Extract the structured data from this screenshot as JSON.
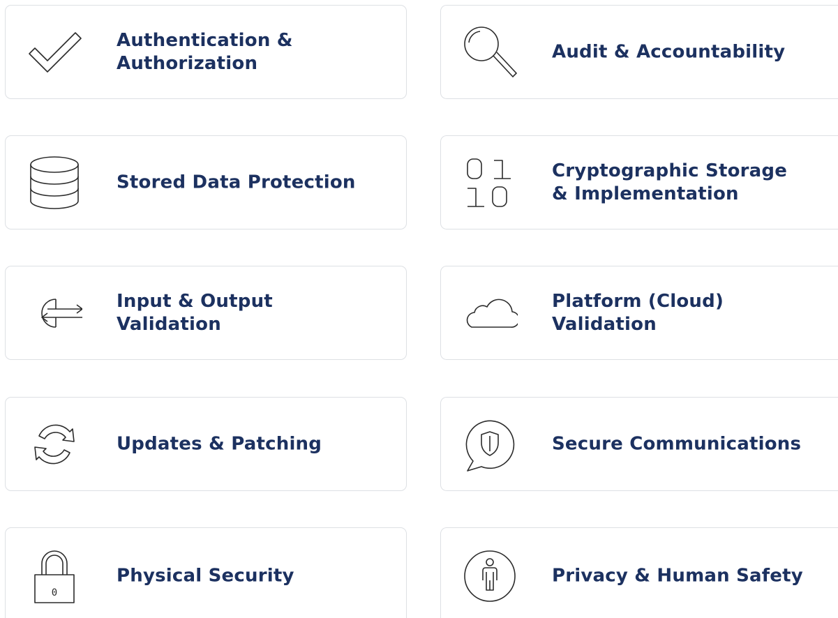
{
  "cards": [
    {
      "label": "Authentication &\nAuthorization",
      "icon": "checkmark-icon"
    },
    {
      "label": "Audit & Accountability",
      "icon": "magnifier-icon"
    },
    {
      "label": "Stored Data Protection",
      "icon": "database-icon"
    },
    {
      "label": "Cryptographic Storage\n& Implementation",
      "icon": "binary-icon"
    },
    {
      "label": "Input & Output\nValidation",
      "icon": "input-output-icon"
    },
    {
      "label": "Platform (Cloud)\nValidation",
      "icon": "cloud-icon"
    },
    {
      "label": "Updates & Patching",
      "icon": "refresh-icon"
    },
    {
      "label": "Secure Communications",
      "icon": "shield-chat-icon"
    },
    {
      "label": "Physical Security",
      "icon": "padlock-icon"
    },
    {
      "label": "Privacy & Human Safety",
      "icon": "person-icon"
    }
  ],
  "colors": {
    "text": "#1c3160",
    "icon_stroke": "#2b2b2b",
    "card_border": "#dde0e4"
  }
}
